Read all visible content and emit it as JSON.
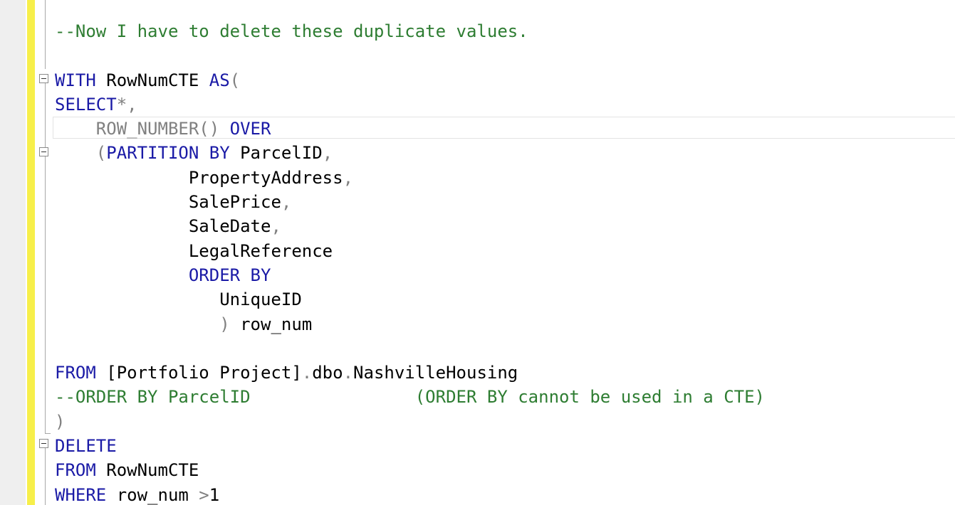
{
  "editor": {
    "lines": [
      {
        "indent": "",
        "tokens": [
          {
            "t": "--Now I have to delete these duplicate values.",
            "c": "cm"
          }
        ]
      },
      {
        "indent": "",
        "tokens": []
      },
      {
        "indent": "",
        "tokens": [
          {
            "t": "WITH",
            "c": "kw"
          },
          {
            "t": " RowNumCTE ",
            "c": "tx"
          },
          {
            "t": "AS",
            "c": "kw"
          },
          {
            "t": "(",
            "c": "gr"
          }
        ]
      },
      {
        "indent": "",
        "tokens": [
          {
            "t": "SELECT",
            "c": "kw"
          },
          {
            "t": "*,",
            "c": "gr"
          }
        ]
      },
      {
        "indent": "    ",
        "tokens": [
          {
            "t": "ROW_NUMBER() ",
            "c": "gr"
          },
          {
            "t": "OVER",
            "c": "kw"
          }
        ]
      },
      {
        "indent": "    ",
        "tokens": [
          {
            "t": "(",
            "c": "gr"
          },
          {
            "t": "PARTITION BY",
            "c": "kw"
          },
          {
            "t": " ParcelID",
            "c": "tx"
          },
          {
            "t": ",",
            "c": "gr"
          }
        ]
      },
      {
        "indent": "             ",
        "tokens": [
          {
            "t": "PropertyAddress",
            "c": "tx"
          },
          {
            "t": ",",
            "c": "gr"
          }
        ]
      },
      {
        "indent": "             ",
        "tokens": [
          {
            "t": "SalePrice",
            "c": "tx"
          },
          {
            "t": ",",
            "c": "gr"
          }
        ]
      },
      {
        "indent": "             ",
        "tokens": [
          {
            "t": "SaleDate",
            "c": "tx"
          },
          {
            "t": ",",
            "c": "gr"
          }
        ]
      },
      {
        "indent": "             ",
        "tokens": [
          {
            "t": "LegalReference",
            "c": "tx"
          }
        ]
      },
      {
        "indent": "             ",
        "tokens": [
          {
            "t": "ORDER BY",
            "c": "kw"
          }
        ]
      },
      {
        "indent": "                ",
        "tokens": [
          {
            "t": "UniqueID",
            "c": "tx"
          }
        ]
      },
      {
        "indent": "                ",
        "tokens": [
          {
            "t": ")",
            "c": "gr"
          },
          {
            "t": " row_num",
            "c": "tx"
          }
        ]
      },
      {
        "indent": "",
        "tokens": []
      },
      {
        "indent": "",
        "tokens": [
          {
            "t": "FROM",
            "c": "kw"
          },
          {
            "t": " [Portfolio Project]",
            "c": "tx"
          },
          {
            "t": ".",
            "c": "gr"
          },
          {
            "t": "dbo",
            "c": "tx"
          },
          {
            "t": ".",
            "c": "gr"
          },
          {
            "t": "NashvilleHousing",
            "c": "tx"
          }
        ]
      },
      {
        "indent": "",
        "tokens": [
          {
            "t": "--ORDER BY ParcelID                (ORDER BY cannot be used in a CTE)",
            "c": "cm"
          }
        ]
      },
      {
        "indent": "",
        "tokens": [
          {
            "t": ")",
            "c": "gr"
          }
        ]
      },
      {
        "indent": "",
        "tokens": [
          {
            "t": "DELETE",
            "c": "kw"
          }
        ]
      },
      {
        "indent": "",
        "tokens": [
          {
            "t": "FROM",
            "c": "kw"
          },
          {
            "t": " RowNumCTE",
            "c": "tx"
          }
        ]
      },
      {
        "indent": "",
        "tokens": [
          {
            "t": "WHERE",
            "c": "kw"
          },
          {
            "t": " row_num ",
            "c": "tx"
          },
          {
            "t": ">",
            "c": "gr"
          },
          {
            "t": "1",
            "c": "tx"
          }
        ]
      }
    ]
  },
  "colors": {
    "keyword": "#1a1aa6",
    "comment": "#2e7d32",
    "operator": "#808080",
    "text": "#000000",
    "change_bar": "#f7ef4a",
    "gutter": "#efefef"
  }
}
